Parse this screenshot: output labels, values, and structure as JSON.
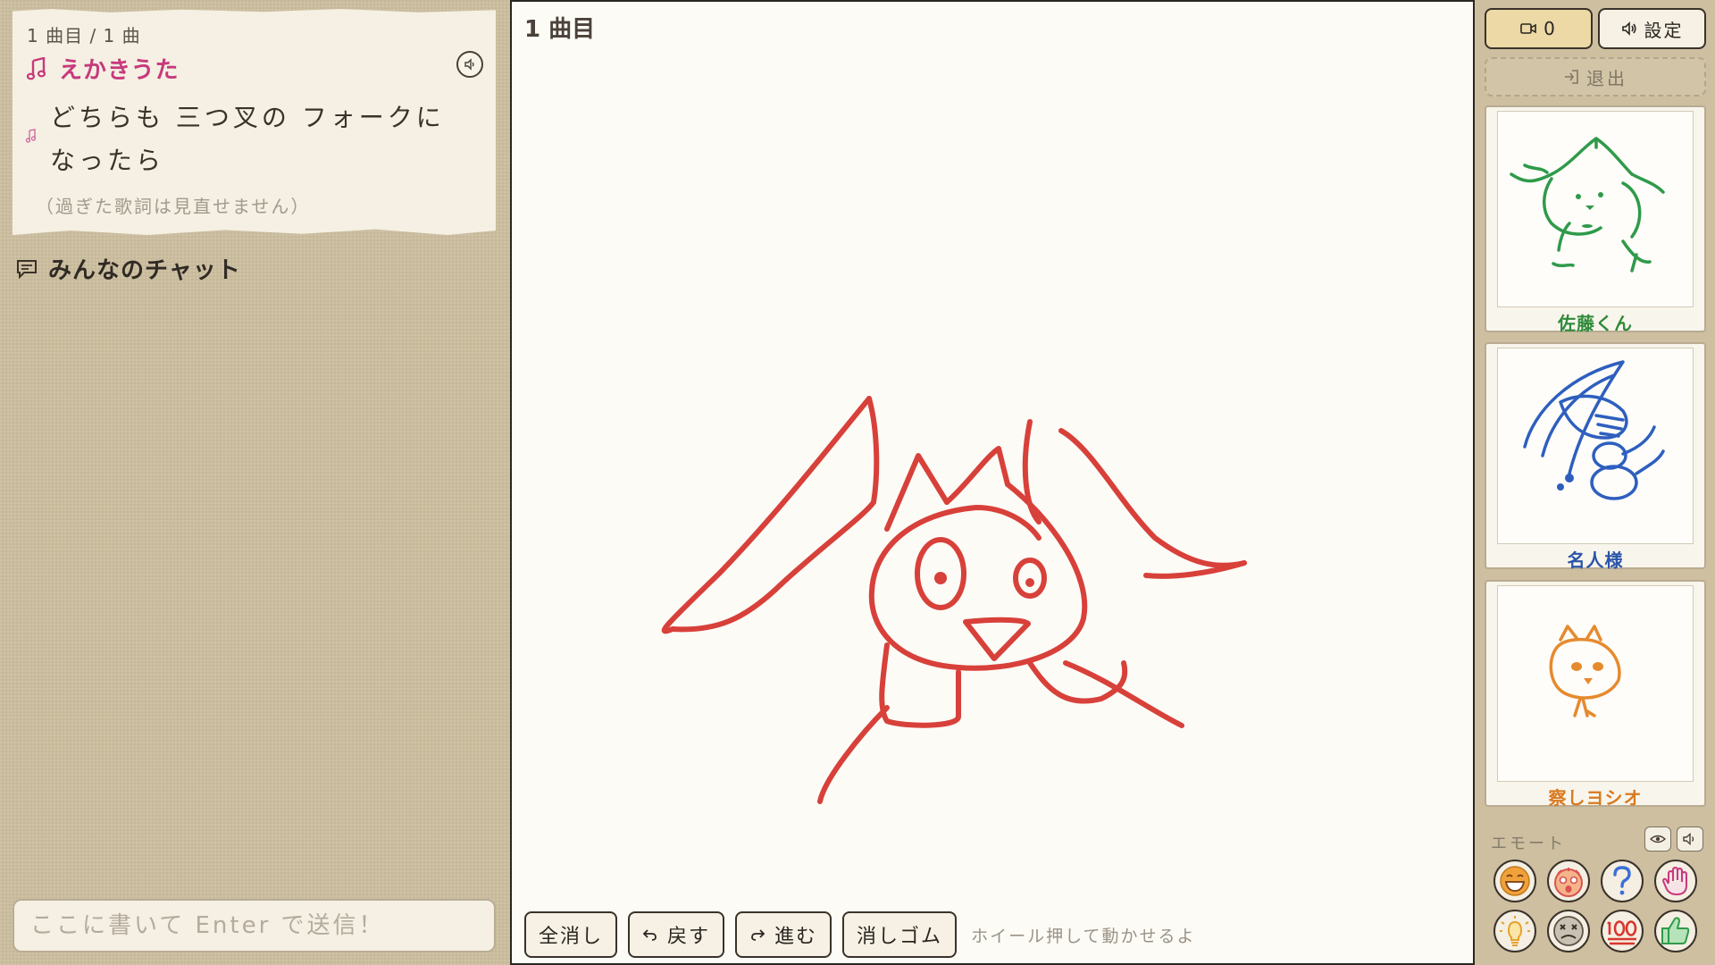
{
  "lyrics": {
    "counter": "1 曲目 / 1 曲",
    "title": "えかきうた",
    "lines": [
      "どちらも 三つ叉の フォークに",
      "なったら"
    ],
    "note": "（過ぎた歌詞は見直せません）"
  },
  "chat": {
    "title": "みんなのチャット",
    "placeholder": "ここに書いて Enter で送信！"
  },
  "canvas": {
    "round_label": "1 曲目",
    "stroke_color": "#d8403a",
    "toolbar": {
      "clear": "全消し",
      "undo": "戻す",
      "redo": "進む",
      "eraser": "消しゴム",
      "hint": "ホイール押して動かせるよ"
    }
  },
  "header": {
    "viewer_count": "0",
    "settings": "設定",
    "exit": "退出"
  },
  "players": [
    {
      "name": "佐藤くん",
      "color": "#2f9a4a"
    },
    {
      "name": "名人様",
      "color": "#2e5fbf"
    },
    {
      "name": "察しヨシオ",
      "color": "#e68a2e"
    }
  ],
  "emotes": {
    "title": "エモート",
    "icons": [
      "laugh-icon",
      "surprised-icon",
      "question-icon",
      "hand-icon",
      "lightbulb-icon",
      "dizzy-icon",
      "hundred-icon",
      "thumbs-up-icon"
    ]
  }
}
